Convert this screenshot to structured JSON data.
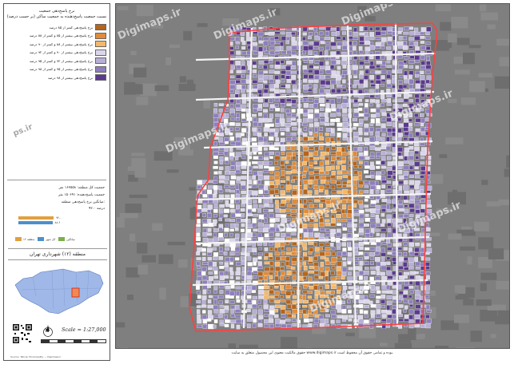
{
  "legend": {
    "title_line1": "نرخ پاسخ‌دهی جمعیت",
    "title_line2": "نسبت جمعیت پاسخ‌دهنده به جمعیت ساکن (بر حسب درصد)",
    "items": [
      {
        "label": "نرخ پاسخ‌دهی کمتر از ۸۵ درصد",
        "color": "#b5651d"
      },
      {
        "label": "نرخ پاسخ‌دهی بیشتر از ۸۵ و کمتر از ۸۸ درصد",
        "color": "#e08c3a"
      },
      {
        "label": "نرخ پاسخ‌دهی بیشتر از ۸۸ و کمتر از ۹۰ درصد",
        "color": "#f4b86a"
      },
      {
        "label": "نرخ پاسخ‌دهی بیشتر از ۹۰ و کمتر از ۹۲ درصد",
        "color": "#dcd6ea"
      },
      {
        "label": "نرخ پاسخ‌دهی بیشتر از ۹۲ و کمتر از ۹۵ درصد",
        "color": "#b8b0d6"
      },
      {
        "label": "نرخ پاسخ‌دهی بیشتر از ۹۵ و کمتر از ۹۸ درصد",
        "color": "#8e7fbd"
      },
      {
        "label": "نرخ پاسخ‌دهی بیشتر از ۹۸ درصد",
        "color": "#5b3a8e"
      }
    ]
  },
  "stats": {
    "total_population": "جمعیت کل منطقه: ۱۶۳۵۵۸ نفر",
    "responded_population": "جمعیت پاسخ‌دهنده: ۱۵۰۶۹۱ نفر",
    "average_rate_label": "میانگین نرخ پاسخ‌دهی منطقه:",
    "average_rate_value": "۹۲.۰ درصد"
  },
  "chart_data": {
    "type": "bar",
    "orientation": "horizontal",
    "categories": [
      "منطقه",
      "کل شهر"
    ],
    "series": [
      {
        "name": "منطقه",
        "values": [
          92.0
        ],
        "color": "#e0a040"
      },
      {
        "name": "شهر",
        "values": [
          88.6
        ],
        "color": "#4d8fcc"
      }
    ],
    "value_labels": [
      "۹۲.۰",
      "۸۸.۶"
    ],
    "legend_items": [
      {
        "label": "منطقه ۱۲",
        "color": "#e0a040"
      },
      {
        "label": "کل شهر",
        "color": "#4d8fcc"
      },
      {
        "label": "میانگین",
        "color": "#7ab04a"
      }
    ]
  },
  "region": {
    "title": "منطقه (۱۲) شهرداری تهران"
  },
  "scale": {
    "text": "Scale = 1:27,000",
    "north_label": "N"
  },
  "watermarks": [
    "Digimaps.ir",
    "Digimaps.ir",
    "Digimaps.ir",
    "Digimaps.ir",
    "Digimaps.ir",
    "Digimaps.ir",
    "Digimaps.ir",
    "Digimaps.ir"
  ],
  "side_watermark": "ps.ir",
  "footer": {
    "small_credit": "Source: Tehran Municipality — Digimaps.ir",
    "copyright": "حقوق مالکیت معنوی این محصول متعلق به سایت www.digimaps.ir بوده و تمامی حقوق آن محفوظ است."
  },
  "colors": {
    "map_background": "#7f7f7f",
    "boundary": "#ff4040",
    "inset_city": "#9fb8e8",
    "inset_region": "#e05030"
  }
}
